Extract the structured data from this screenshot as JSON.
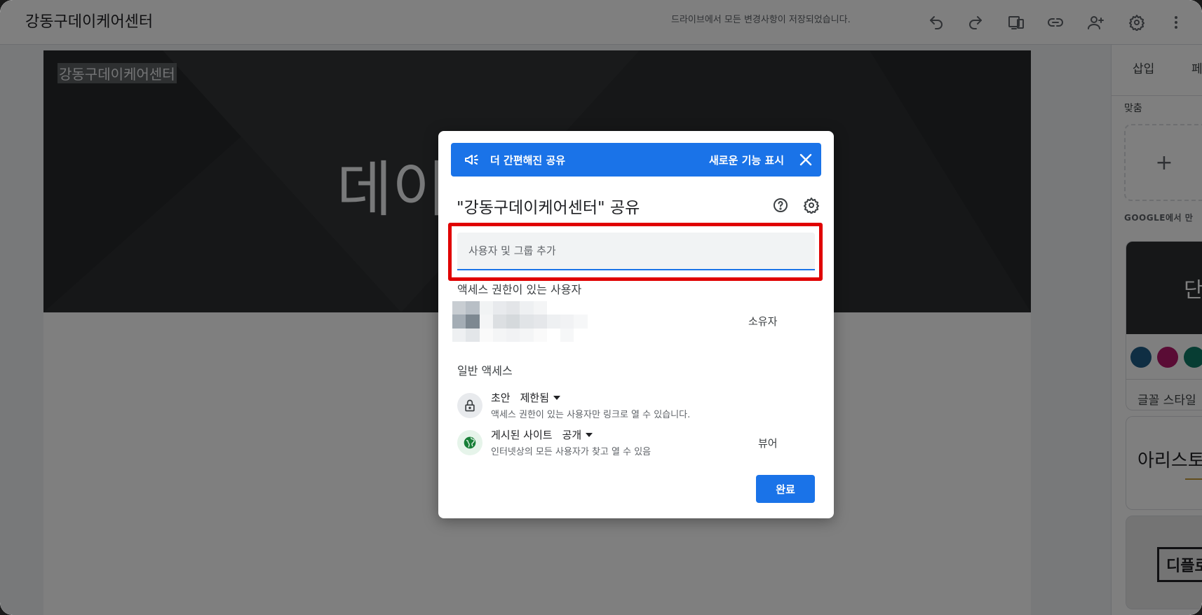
{
  "document": {
    "title": "강동구데이케어센터",
    "saved_status": "드라이브에서 모든 변경사항이 저장되었습니다."
  },
  "toolbar": {
    "icons": [
      "undo-icon",
      "redo-icon",
      "preview-device-icon",
      "link-icon",
      "add-person-icon",
      "gear-icon",
      "more-vert-icon"
    ]
  },
  "hero": {
    "small_title": "강동구데이케어센터",
    "big_title": "데이"
  },
  "right_panel": {
    "tab_insert": "삽입",
    "tab_pages": "페",
    "custom_label": "맞춤",
    "plus": "+",
    "google_label": "GOOGLE에서 만",
    "theme1_preview": "단",
    "theme1_font": "글꼴 스타일",
    "theme1_colors": [
      "#1f5c87",
      "#b5186b",
      "#0f7a66"
    ],
    "theme2_preview": "아리스토",
    "theme3_preview": "디플로"
  },
  "share_dialog": {
    "banner_text": "더 간편해진 공유",
    "banner_link": "새로운 기능 표시",
    "title": "\"강동구데이케어센터\" 공유",
    "add_input_placeholder": "사용자 및 그룹 추가",
    "access_section_label": "액세스 권한이 있는 사용자",
    "owner_role": "소유자",
    "general_access_label": "일반 액세스",
    "draft": {
      "label": "초안",
      "value": "제한됨",
      "description": "액세스 권한이 있는 사용자만 링크로 열 수 있습니다."
    },
    "published": {
      "label": "게시된 사이트",
      "value": "공개",
      "description": "인터넷상의 모든 사용자가 찾고 열 수 있음",
      "role": "뷰어"
    },
    "done_label": "완료",
    "colors": {
      "accent": "#1a73e8",
      "highlight": "#e00000"
    }
  }
}
